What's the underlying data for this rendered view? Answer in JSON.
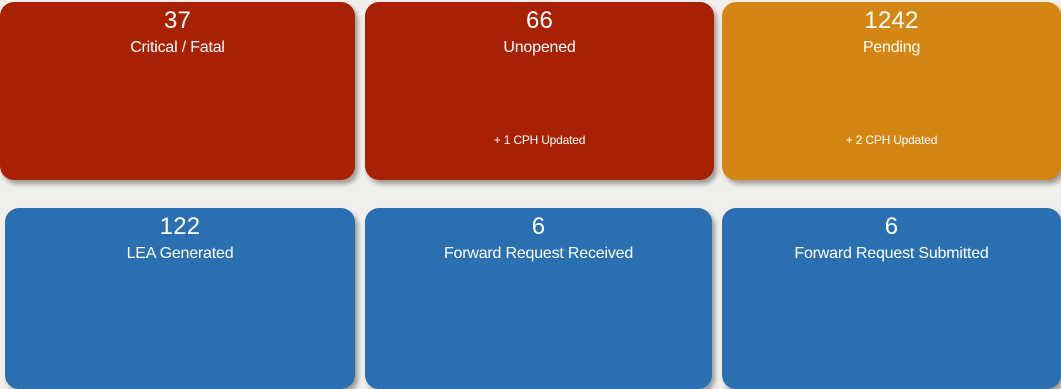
{
  "tiles": [
    {
      "count": "37",
      "label": "Critical / Fatal",
      "sub": "",
      "color": "#a82104"
    },
    {
      "count": "66",
      "label": "Unopened",
      "sub": "+ 1 CPH Updated",
      "color": "#a82104"
    },
    {
      "count": "1242",
      "label": "Pending",
      "sub": "+ 2 CPH Updated",
      "color": "#d38712"
    },
    {
      "count": "122",
      "label": "LEA Generated",
      "sub": "",
      "color": "#2a6fb0"
    },
    {
      "count": "6",
      "label": "Forward Request Received",
      "sub": "",
      "color": "#2a6fb0"
    },
    {
      "count": "6",
      "label": "Forward Request Submitted",
      "sub": "",
      "color": "#2a6fb0"
    }
  ]
}
